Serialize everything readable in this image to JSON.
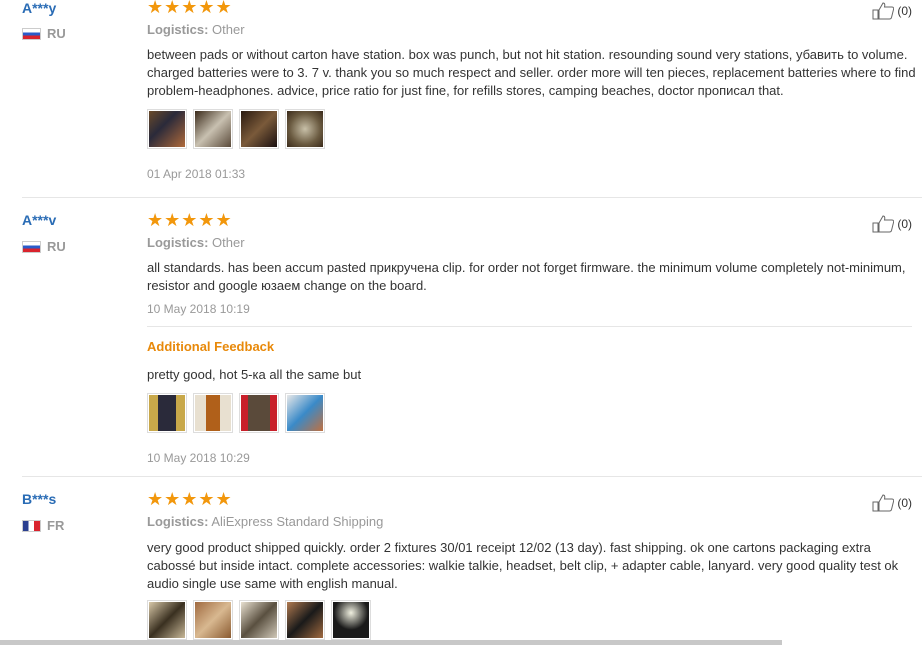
{
  "reviews": [
    {
      "user": "A***y",
      "country": "RU",
      "stars": "★★★★★",
      "logistics_label": "Logistics:",
      "logistics_value": "Other",
      "text": "between pads or without carton have station. box was punch, but not hit station. resounding sound very stations, убавить to volume. charged batteries were to 3. 7 v. thank you so much respect and seller. order more will ten pieces, replacement batteries where to find problem-headphones. advice, price ratio for just fine, for refills stores, camping beaches, doctor прописал that.",
      "date": "01 Apr 2018 01:33",
      "likes": "(0)"
    },
    {
      "user": "A***v",
      "country": "RU",
      "stars": "★★★★★",
      "logistics_label": "Logistics:",
      "logistics_value": "Other",
      "text": "all standards. has been accum pasted прикручена clip. for order not forget firmware. the minimum volume completely not-minimum, resistor and google юзаем change on the board.",
      "date": "10 May 2018 10:19",
      "likes": "(0)",
      "additional_title": "Additional Feedback",
      "additional_text": "pretty good, hot 5-ка all the same but",
      "additional_date": "10 May 2018 10:29"
    },
    {
      "user": "B***s",
      "country": "FR",
      "stars": "★★★★★",
      "logistics_label": "Logistics:",
      "logistics_value": "AliExpress Standard Shipping",
      "text": "very good product shipped quickly. order 2 fixtures 30/01 receipt 12/02 (13 day). fast shipping. ok one cartons packaging extra cabossé but inside intact. complete accessories: walkie talkie, headset, belt clip, + adapter cable, lanyard. very good quality test ok audio single use same with english manual.",
      "likes": "(0)"
    }
  ],
  "colors": {
    "accent": "#f2970c",
    "username": "#2a6cb5",
    "additional": "#e8890a"
  },
  "icons": {
    "like": "thumbs-up-icon",
    "star": "star-icon"
  }
}
